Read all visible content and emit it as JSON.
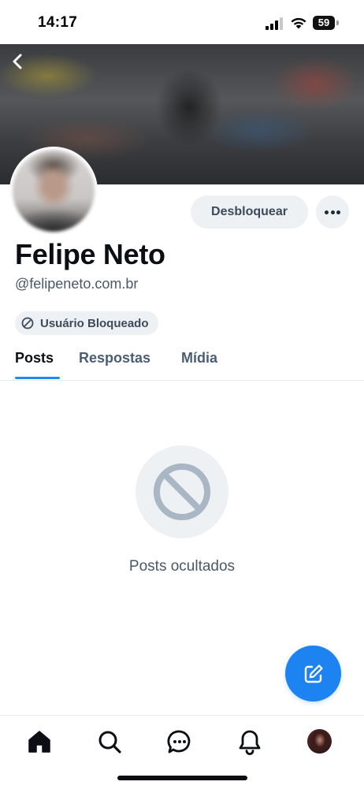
{
  "status_bar": {
    "time": "14:17",
    "battery": "59"
  },
  "profile": {
    "display_name": "Felipe Neto",
    "handle": "@felipeneto.com.br",
    "blocked_badge": "Usuário Bloqueado",
    "unblock_label": "Desbloquear"
  },
  "tabs": [
    {
      "label": "Posts",
      "active": true
    },
    {
      "label": "Respostas",
      "active": false
    },
    {
      "label": "Mídia",
      "active": false
    }
  ],
  "empty_state": {
    "text": "Posts ocultados",
    "icon": "blocked-icon"
  },
  "bottom_nav": {
    "items": [
      "home-icon",
      "search-icon",
      "chat-icon",
      "bell-icon",
      "profile-avatar"
    ]
  },
  "colors": {
    "accent": "#1d83f0",
    "tab_underline": "#1d8cf0",
    "muted_text": "#4a5868",
    "chip_bg": "#eef1f4"
  }
}
